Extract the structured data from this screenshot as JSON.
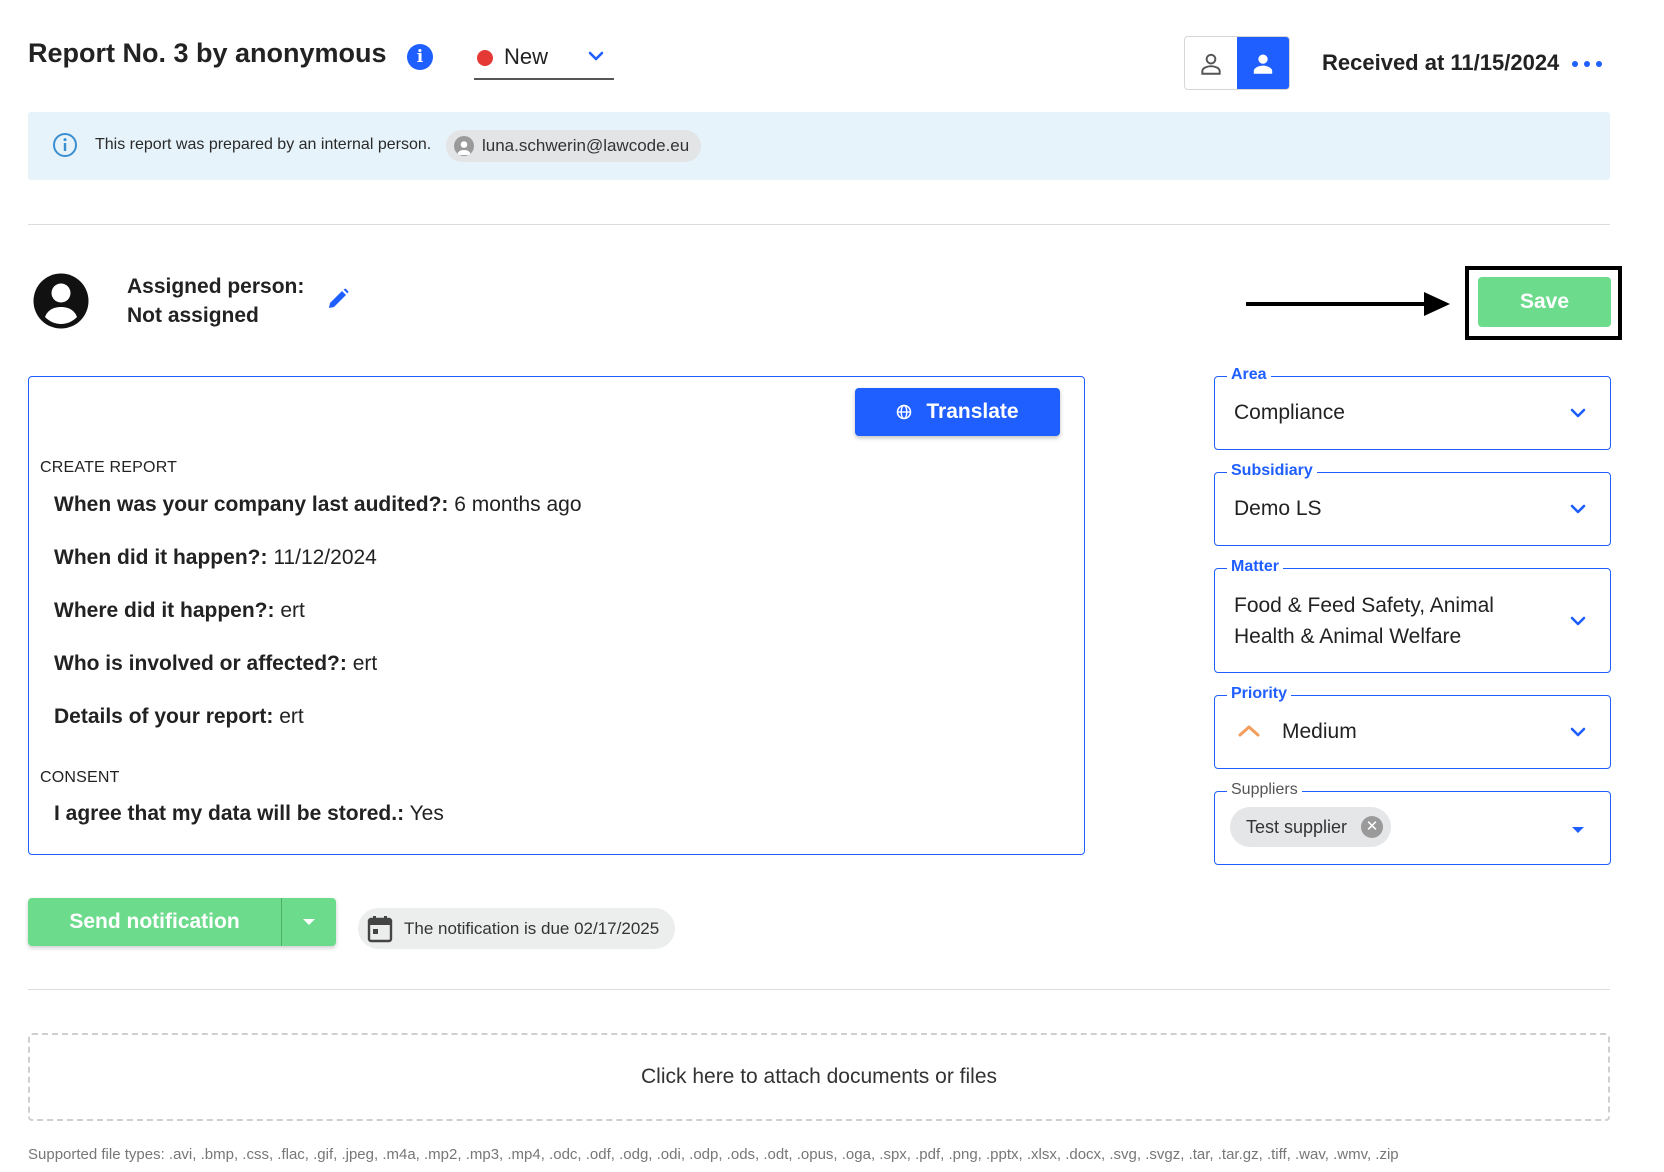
{
  "header": {
    "title": "Report No. 3 by anonymous",
    "info_glyph": "i",
    "status": "New",
    "status_color": "#e53935",
    "received": "Received at 11/15/2024"
  },
  "banner": {
    "text": "This report was prepared by an internal person.",
    "email": "luna.schwerin@lawcode.eu"
  },
  "assigned": {
    "label": "Assigned person:",
    "value": "Not assigned"
  },
  "save_label": "Save",
  "report": {
    "translate_label": "Translate",
    "sections": [
      {
        "heading": "CREATE REPORT",
        "items": [
          {
            "q": "When was your company last audited?:",
            "a": "6 months ago"
          },
          {
            "q": "When did it happen?:",
            "a": "11/12/2024"
          },
          {
            "q": "Where did it happen?:",
            "a": "ert"
          },
          {
            "q": "Who is involved or affected?:",
            "a": "ert"
          },
          {
            "q": "Details of your report:",
            "a": "ert"
          }
        ]
      },
      {
        "heading": "CONSENT",
        "items": [
          {
            "q": "I agree that my data will be stored.:",
            "a": "Yes"
          }
        ]
      }
    ]
  },
  "fields": {
    "area": {
      "label": "Area",
      "value": "Compliance"
    },
    "subsidiary": {
      "label": "Subsidiary",
      "value": "Demo LS"
    },
    "matter": {
      "label": "Matter",
      "value_line1": "Food & Feed Safety, Animal",
      "value_line2": "Health & Animal Welfare"
    },
    "priority": {
      "label": "Priority",
      "value": "Medium",
      "icon_color": "#f29d5b"
    },
    "suppliers": {
      "label": "Suppliers",
      "chip": "Test supplier"
    }
  },
  "notification": {
    "send_label": "Send notification",
    "due_text": "The notification is due 02/17/2025"
  },
  "attach": {
    "label": "Click here to attach documents or files",
    "supported": "Supported file types: .avi, .bmp, .css, .flac, .gif, .jpeg, .m4a, .mp2, .mp3, .mp4, .odc, .odf, .odg, .odi, .odp, .ods, .odt, .opus, .oga, .spx, .pdf, .png, .pptx, .xlsx, .docx, .svg, .svgz, .tar, .tar.gz, .tiff, .wav, .wmv, .zip"
  },
  "colors": {
    "accent": "#1f5eff",
    "success": "#6ddb8c",
    "banner_bg": "#e6f3fa"
  }
}
